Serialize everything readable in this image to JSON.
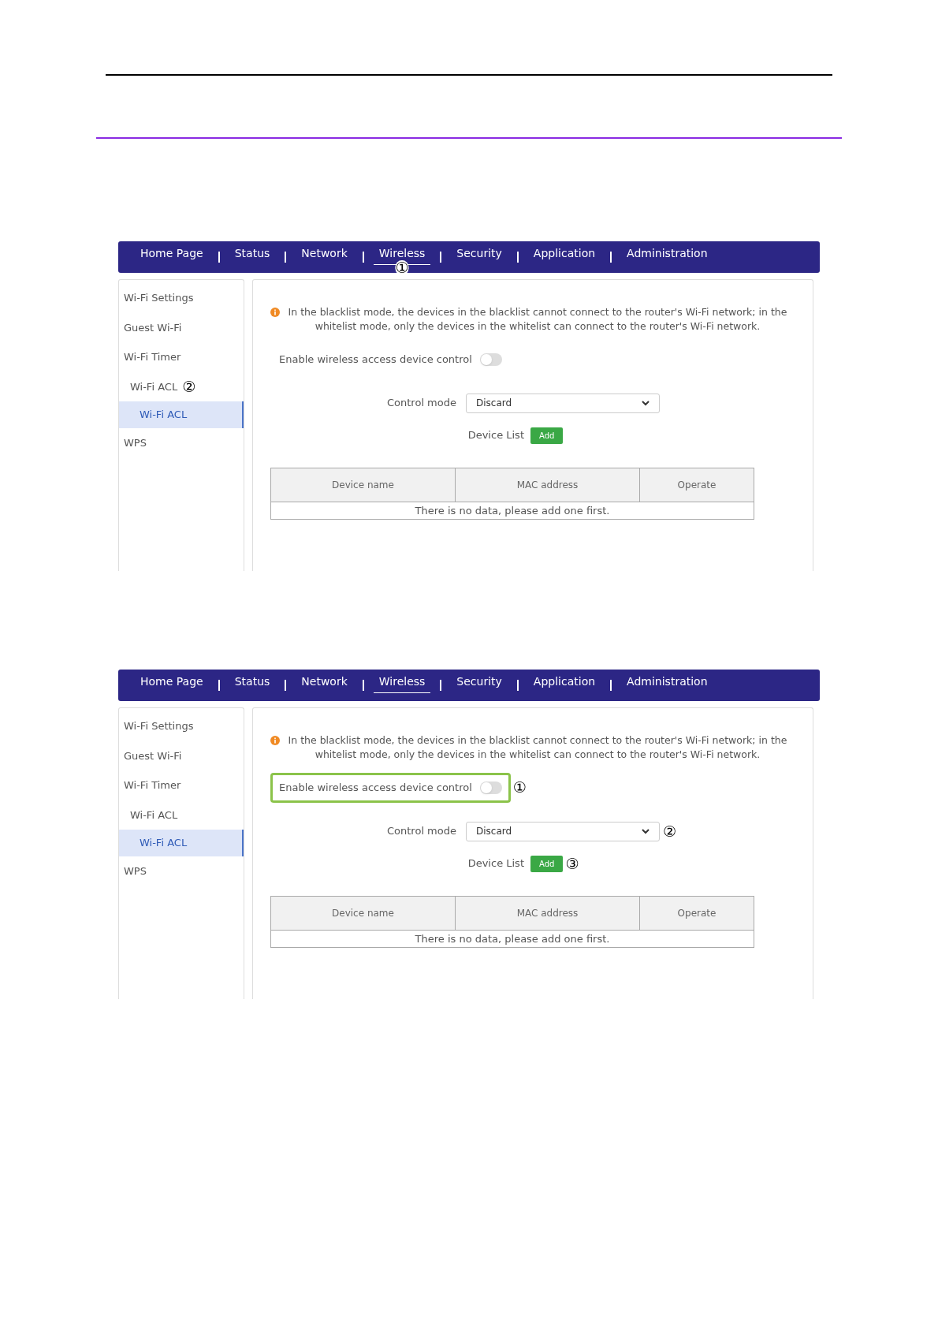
{
  "shots": [
    {
      "tabs": [
        {
          "label": "Home Page",
          "selected": false
        },
        {
          "label": "Status",
          "selected": false
        },
        {
          "label": "Network",
          "selected": false
        },
        {
          "label": "Wireless",
          "selected": true,
          "callout": "①"
        },
        {
          "label": "Security",
          "selected": false
        },
        {
          "label": "Application",
          "selected": false
        },
        {
          "label": "Administration",
          "selected": false
        }
      ],
      "sidebar": [
        {
          "label": "Wi-Fi Settings",
          "selected": false
        },
        {
          "label": "Guest Wi-Fi",
          "selected": false
        },
        {
          "label": "Wi-Fi Timer",
          "selected": false
        },
        {
          "label": "Wi-Fi ACL",
          "selected": false,
          "callout": "②",
          "children": [
            {
              "label": "Wi-Fi ACL",
              "selected": true
            }
          ]
        },
        {
          "label": "WPS",
          "selected": false
        }
      ],
      "notice": "In the blacklist mode, the devices in the blacklist cannot connect to the router's Wi-Fi network; in the whitelist mode, only the devices in the whitelist can connect to the router's Wi-Fi network.",
      "toggle": {
        "label": "Enable wireless access device control",
        "on": false,
        "highlighted": false
      },
      "control_mode": {
        "label": "Control mode",
        "value": "Discard"
      },
      "device_list": {
        "label": "Device List",
        "button": {
          "label": "Add"
        }
      },
      "table": {
        "columns": [
          "Device name",
          "MAC address",
          "Operate"
        ],
        "empty_text": "There is no data, please add one first."
      }
    },
    {
      "tabs": [
        {
          "label": "Home Page",
          "selected": false
        },
        {
          "label": "Status",
          "selected": false
        },
        {
          "label": "Network",
          "selected": false
        },
        {
          "label": "Wireless",
          "selected": true
        },
        {
          "label": "Security",
          "selected": false
        },
        {
          "label": "Application",
          "selected": false
        },
        {
          "label": "Administration",
          "selected": false
        }
      ],
      "sidebar": [
        {
          "label": "Wi-Fi Settings",
          "selected": false
        },
        {
          "label": "Guest Wi-Fi",
          "selected": false
        },
        {
          "label": "Wi-Fi Timer",
          "selected": false
        },
        {
          "label": "Wi-Fi ACL",
          "selected": false,
          "children": [
            {
              "label": "Wi-Fi ACL",
              "selected": true
            }
          ]
        },
        {
          "label": "WPS",
          "selected": false
        }
      ],
      "notice": "In the blacklist mode, the devices in the blacklist cannot connect to the router's Wi-Fi network; in the whitelist mode, only the devices in the whitelist can connect to the router's Wi-Fi network.",
      "toggle": {
        "label": "Enable wireless access device control",
        "on": false,
        "highlighted": true,
        "callout": "①"
      },
      "control_mode": {
        "label": "Control mode",
        "value": "Discard",
        "callout": "②"
      },
      "device_list": {
        "label": "Device List",
        "button": {
          "label": "Add",
          "callout": "③"
        }
      },
      "table": {
        "columns": [
          "Device name",
          "MAC address",
          "Operate"
        ],
        "empty_text": "There is no data, please add one first."
      }
    }
  ]
}
